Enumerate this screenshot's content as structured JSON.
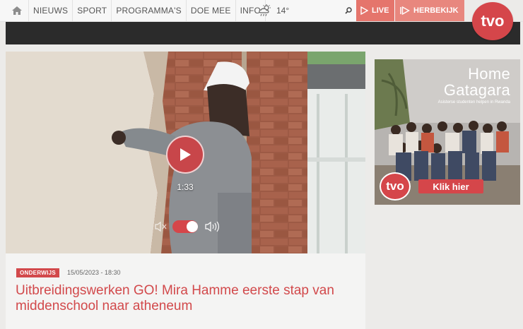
{
  "nav": {
    "home_icon": "home-icon",
    "items": [
      {
        "label": "NIEUWS"
      },
      {
        "label": "SPORT"
      },
      {
        "label": "PROGRAMMA'S"
      },
      {
        "label": "DOE MEE"
      },
      {
        "label": "INFO"
      }
    ],
    "weather": {
      "icon": "cloud-sun-rain-icon",
      "temperature": "14°"
    },
    "search_icon": "search-icon",
    "live_label": "LIVE",
    "herbekijk_label": "HERBEKIJK",
    "logo_text": "tvo"
  },
  "video": {
    "duration": "1:33",
    "play_icon": "play-icon",
    "mute_icon": "mute-icon",
    "volume_icon": "volume-icon",
    "sound_on": true
  },
  "article": {
    "category": "ONDERWIJS",
    "date": "15/05/2023 - 18:30",
    "title": "Uitbreidingswerken GO! Mira Hamme eerste stap van middenschool naar atheneum"
  },
  "ad": {
    "title_line1": "Home",
    "title_line2": "Gatagara",
    "subtitle": "Asisterse studenten helpen in Rwanda",
    "logo_text": "tvo",
    "button_label": "Klik hier"
  },
  "colors": {
    "brand": "#d5464a",
    "live_bg": "#e5756c",
    "herbekijk_bg": "#e8877e",
    "header_dark": "#2b2b2b",
    "page_bg": "#ecebe9"
  }
}
